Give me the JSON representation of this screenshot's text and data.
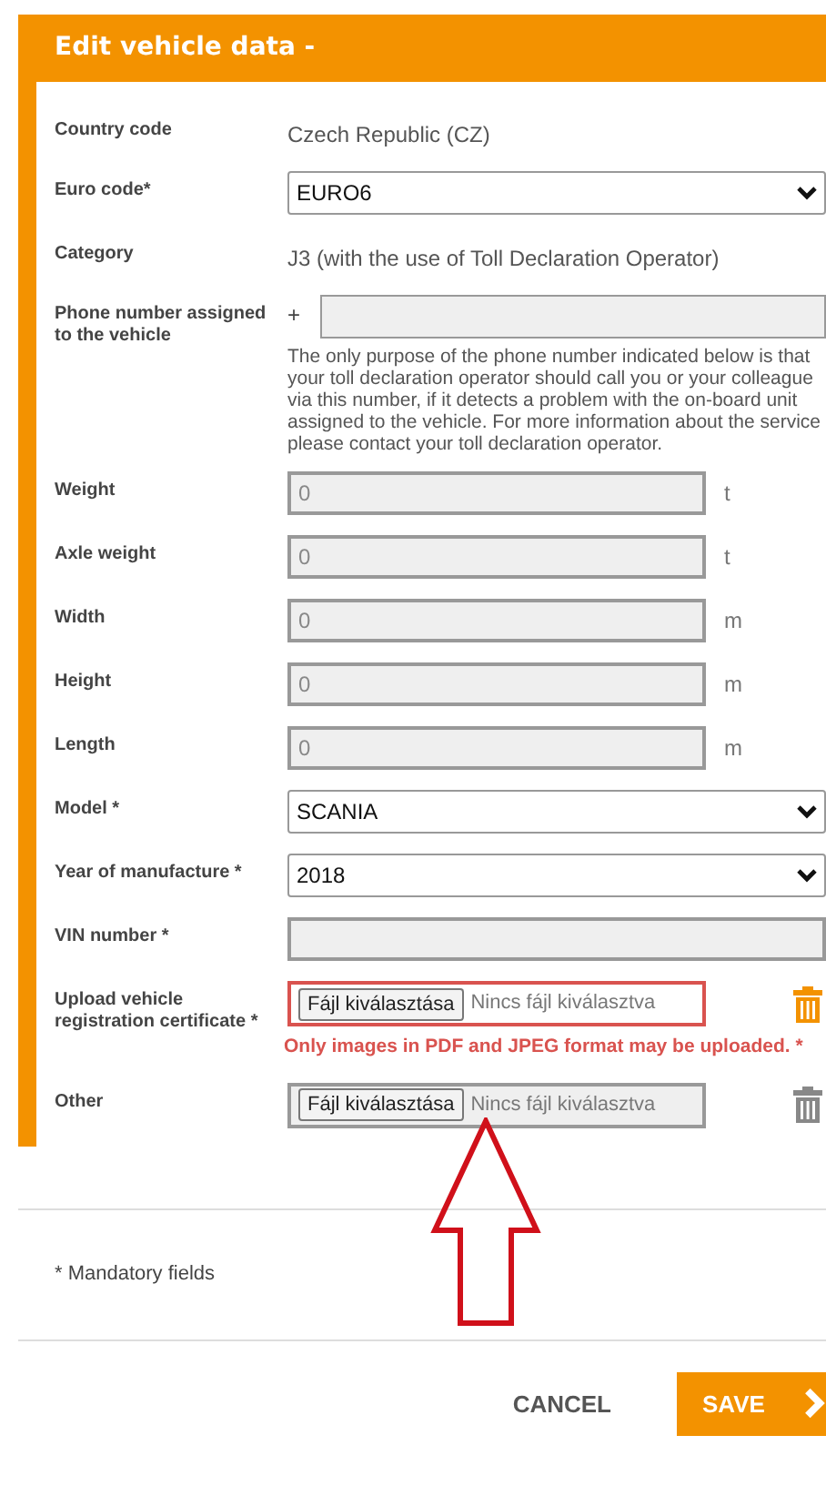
{
  "dialog": {
    "title": "Edit vehicle data -"
  },
  "fields": [
    {
      "kind": "text",
      "label": "Country code",
      "value": "Czech Republic (CZ)"
    },
    {
      "kind": "select",
      "label": "Euro code*",
      "value": "EURO6"
    },
    {
      "kind": "text",
      "label": "Category",
      "value": "J3 (with the use of Toll Declaration Operator)"
    },
    {
      "kind": "phone",
      "label": "Phone number assigned to the vehicle",
      "prefix": "+",
      "disabled": true,
      "help": "The only purpose of the phone number indicated below is that your toll declaration operator should call you or your colleague via this number, if it detects a problem with the on-board unit assigned to the vehicle. For more information about the service please contact your toll declaration operator."
    },
    {
      "kind": "number",
      "label": "Weight",
      "value": "0",
      "unit": "t",
      "disabled": true
    },
    {
      "kind": "number",
      "label": "Axle weight",
      "value": "0",
      "unit": "t",
      "disabled": true
    },
    {
      "kind": "number",
      "label": "Width",
      "value": "0",
      "unit": "m",
      "disabled": true
    },
    {
      "kind": "number",
      "label": "Height",
      "value": "0",
      "unit": "m",
      "disabled": true
    },
    {
      "kind": "number",
      "label": "Length",
      "value": "0",
      "unit": "m",
      "disabled": true
    },
    {
      "kind": "select",
      "label": "Model *",
      "value": "SCANIA"
    },
    {
      "kind": "select",
      "label": "Year of manufacture *",
      "value": "2018"
    },
    {
      "kind": "number",
      "label": "VIN number *",
      "disabled": true
    },
    {
      "kind": "file",
      "label": "Upload vehicle registration certificate *",
      "button": "Fájl kiválasztása",
      "status": "Nincs fájl kiválasztva",
      "invalid": true,
      "error": "Only images in PDF and JPEG format may be uploaded. *",
      "delete_enabled": true
    },
    {
      "kind": "file",
      "label": "Other",
      "button": "Fájl kiválasztása",
      "status": "Nincs fájl kiválasztva",
      "invalid": false,
      "delete_enabled": false
    }
  ],
  "footnote": "* Mandatory fields",
  "buttons": {
    "cancel": "CANCEL",
    "save": "SAVE"
  }
}
